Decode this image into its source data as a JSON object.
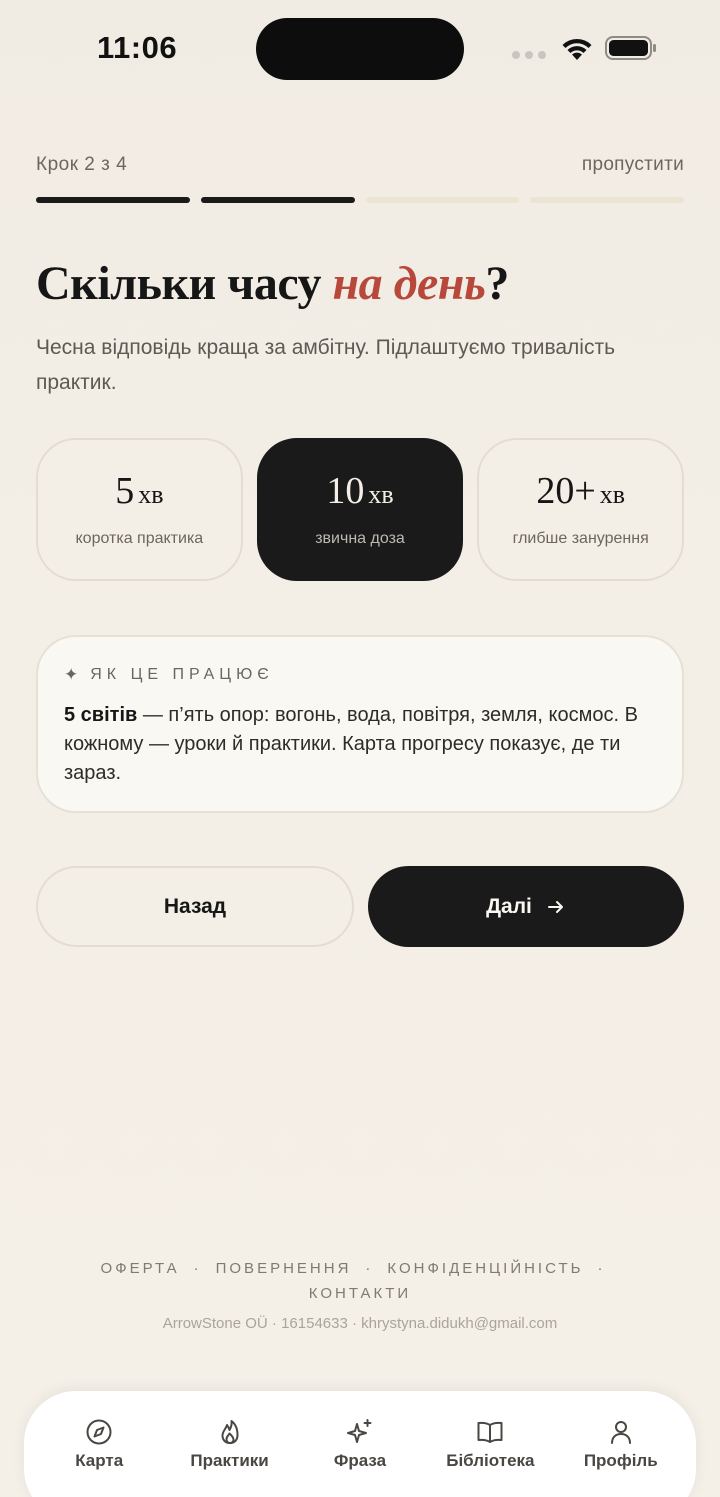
{
  "status_bar": {
    "time": "11:06"
  },
  "header": {
    "step_label": "Крок 2 з 4",
    "skip_label": "пропустити",
    "progress": {
      "total_steps": 4,
      "completed_steps": 2
    }
  },
  "question": {
    "title_before": "Скільки часу ",
    "title_accent": "на день",
    "title_after": "?",
    "subtitle": "Чесна відповідь краща за амбітну. Підлаштуємо тривалість практик."
  },
  "options": [
    {
      "value": "5",
      "unit": "хв",
      "caption": "коротка практика",
      "selected": false
    },
    {
      "value": "10",
      "unit": "хв",
      "caption": "звична доза",
      "selected": true
    },
    {
      "value": "20+",
      "unit": "хв",
      "caption": "глибше занурення",
      "selected": false
    }
  ],
  "info_card": {
    "icon": "sparkle-icon",
    "title": "ЯК ЦЕ ПРАЦЮЄ",
    "body_bold": "5 світів",
    "body_text": " — п’ять опор: вогонь, вода, повітря, земля, космос. В кожному — уроки й практики. Карта прогресу показує, де ти зараз."
  },
  "buttons": {
    "back_label": "Назад",
    "next_label": "Далі"
  },
  "footer": {
    "links": [
      "ОФЕРТА",
      "ПОВЕРНЕННЯ",
      "КОНФІДЕНЦІЙНІСТЬ",
      "КОНТАКТИ"
    ],
    "separator": "·",
    "meta": "ArrowStone OÜ · 16154633 · khrystyna.didukh@gmail.com"
  },
  "tabbar": {
    "items": [
      {
        "label": "Карта",
        "icon": "compass-icon"
      },
      {
        "label": "Практики",
        "icon": "flame-icon"
      },
      {
        "label": "Фраза",
        "icon": "sparkles-icon"
      },
      {
        "label": "Бібліотека",
        "icon": "book-icon"
      },
      {
        "label": "Профіль",
        "icon": "user-icon"
      }
    ]
  },
  "colors": {
    "background": "#f3eee6",
    "accent": "#b8483c",
    "primary_dark": "#1a1a1a",
    "progress_inactive": "#ebe4d3"
  }
}
